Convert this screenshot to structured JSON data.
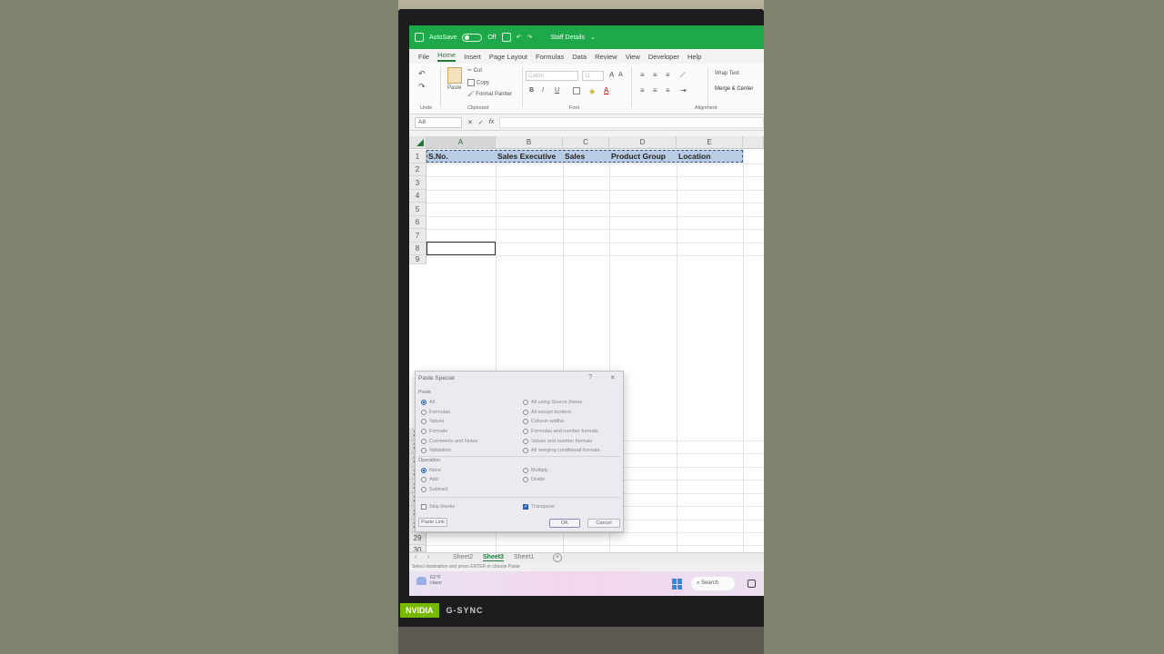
{
  "titlebar": {
    "autosave_label": "AutoSave",
    "autosave_state": "Off",
    "file_title": "Staff Details"
  },
  "menu": {
    "tabs": [
      "File",
      "Home",
      "Insert",
      "Page Layout",
      "Formulas",
      "Data",
      "Review",
      "View",
      "Developer",
      "Help"
    ],
    "active": "Home"
  },
  "ribbon": {
    "undo_label": "Undo",
    "paste_label": "Paste",
    "cut_label": "Cut",
    "copy_label": "Copy",
    "format_painter_label": "Format Painter",
    "clipboard_label": "Clipboard",
    "font_name": "Calibri",
    "font_size": "11",
    "font_label": "Font",
    "bold": "B",
    "italic": "I",
    "underline": "U",
    "wrap_text_label": "Wrap Text",
    "merge_label": "Merge & Center",
    "alignment_label": "Alignment"
  },
  "formula_bar": {
    "name_box": "A8",
    "fx": "fx"
  },
  "grid": {
    "columns": [
      "A",
      "B",
      "C",
      "D",
      "E"
    ],
    "rows_top": [
      "1",
      "2",
      "3",
      "4",
      "5",
      "6",
      "7",
      "8",
      "9"
    ],
    "rows_bottom": [
      "21",
      "22",
      "23",
      "24",
      "25",
      "26",
      "27",
      "28",
      "29",
      "30"
    ],
    "header_row": [
      "S.No.",
      "Sales Executive",
      "Sales",
      "Product Group",
      "Location"
    ]
  },
  "dialog": {
    "title": "Paste Special",
    "help": "?",
    "close": "×",
    "paste_section": "Paste",
    "paste_left": [
      "All",
      "Formulas",
      "Values",
      "Formats",
      "Comments and Notes",
      "Validation"
    ],
    "paste_right": [
      "All using Source theme",
      "All except borders",
      "Column widths",
      "Formulas and number formats",
      "Values and number formats",
      "All merging conditional formats"
    ],
    "operation_section": "Operation",
    "operation_left": [
      "None",
      "Add",
      "Subtract"
    ],
    "operation_right": [
      "Multiply",
      "Divide"
    ],
    "skip_blanks": "Skip blanks",
    "transpose": "Transpose",
    "paste_link": "Paste Link",
    "ok": "OK",
    "cancel": "Cancel"
  },
  "sheets": {
    "tabs": [
      "Sheet2",
      "Sheet3",
      "Sheet1"
    ],
    "active": "Sheet3",
    "add": "+"
  },
  "status": "Select destination and press ENTER or choose Paste",
  "taskbar": {
    "temperature": "62°F",
    "weather": "Haze",
    "search": "Search"
  },
  "bezel": {
    "brand": "NVIDIA",
    "gsync": "G-SYNC"
  },
  "colors": {
    "excel_green": "#1fa84a",
    "header_fill": "#b8cce4"
  }
}
